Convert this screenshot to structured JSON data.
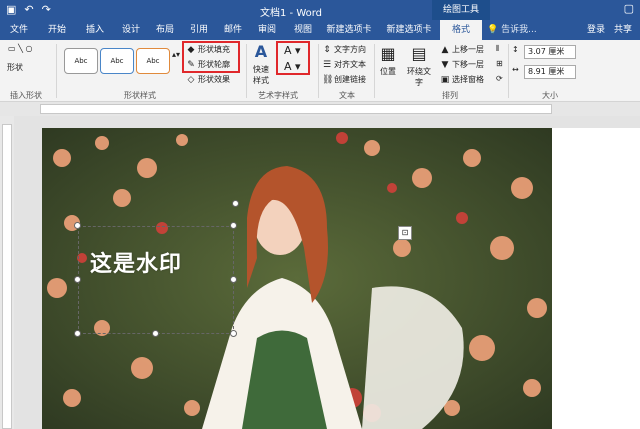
{
  "title_bar": {
    "doc_title": "文档1 - Word",
    "tool_tab": "绘图工具",
    "qat": [
      "save-icon",
      "undo-icon",
      "redo-icon"
    ]
  },
  "tabs": [
    "文件",
    "开始",
    "插入",
    "设计",
    "布局",
    "引用",
    "邮件",
    "审阅",
    "视图",
    "新建选项卡",
    "新建选项卡",
    "格式"
  ],
  "active_tab": "格式",
  "tell_me": "告诉我...",
  "login": "登录",
  "share": "共享",
  "ribbon": {
    "insert_shapes": {
      "button": "形状",
      "label": "插入形状"
    },
    "shape_styles": {
      "label": "形状样式",
      "styles": [
        "Abc",
        "Abc",
        "Abc"
      ],
      "fill": "形状填充",
      "outline": "形状轮廓",
      "effects": "形状效果"
    },
    "wordart": {
      "label": "艺术字样式",
      "quick": "快速样式"
    },
    "text": {
      "label": "文本",
      "direction": "文字方向",
      "align": "对齐文本",
      "link": "创建链接"
    },
    "arrange": {
      "label": "排列",
      "position": "位置",
      "wrap": "环绕文字",
      "bring_forward": "上移一层",
      "send_backward": "下移一层",
      "selection_pane": "选择窗格"
    },
    "size": {
      "label": "大小",
      "height": "3.07 厘米",
      "width": "8.91 厘米"
    }
  },
  "document": {
    "watermark_text": "这是水印"
  },
  "colors": {
    "brand": "#2b579a",
    "highlight": "#e0282b"
  }
}
